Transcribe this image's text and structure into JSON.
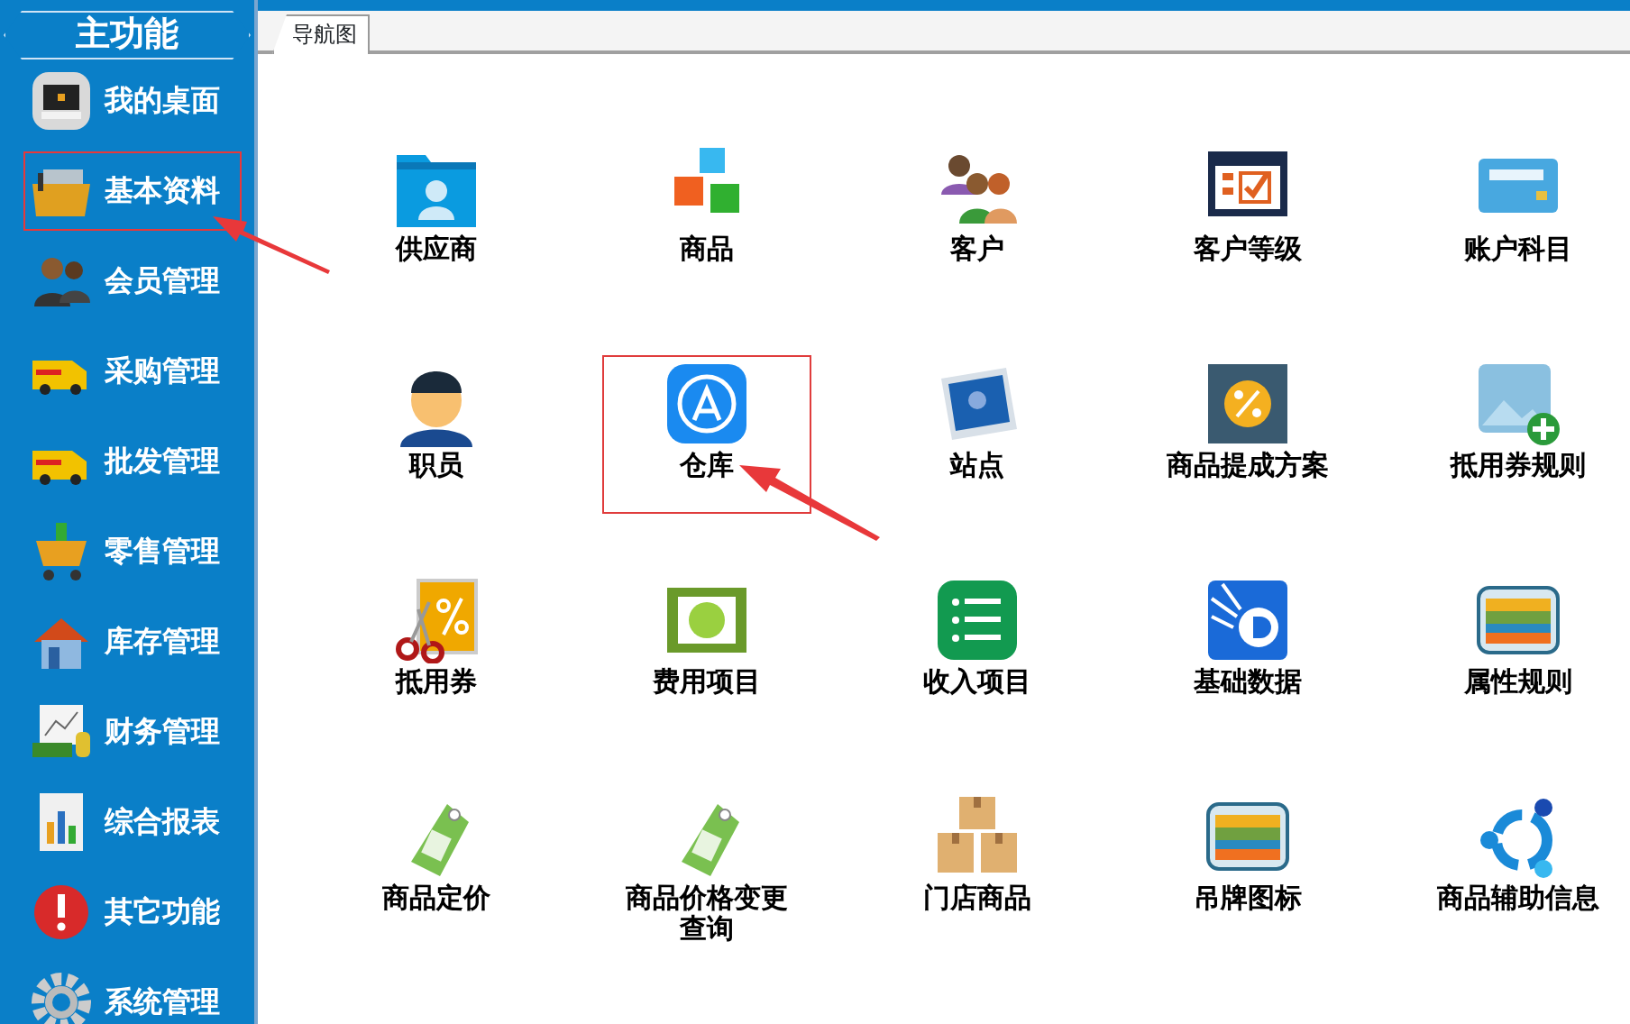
{
  "sidebar": {
    "title": "主功能",
    "items": [
      {
        "label": "我的桌面",
        "selected": false
      },
      {
        "label": "基本资料",
        "selected": true
      },
      {
        "label": "会员管理",
        "selected": false
      },
      {
        "label": "采购管理",
        "selected": false
      },
      {
        "label": "批发管理",
        "selected": false
      },
      {
        "label": "零售管理",
        "selected": false
      },
      {
        "label": "库存管理",
        "selected": false
      },
      {
        "label": "财务管理",
        "selected": false
      },
      {
        "label": "综合报表",
        "selected": false
      },
      {
        "label": "其它功能",
        "selected": false
      },
      {
        "label": "系统管理",
        "selected": false
      }
    ]
  },
  "tabs": [
    {
      "label": "导航图",
      "selected": true
    }
  ],
  "nav_grid": {
    "items": [
      {
        "label": "供应商",
        "selected": false
      },
      {
        "label": "商品",
        "selected": false
      },
      {
        "label": "客户",
        "selected": false
      },
      {
        "label": "客户等级",
        "selected": false
      },
      {
        "label": "账户科目",
        "selected": false
      },
      {
        "label": "职员",
        "selected": false
      },
      {
        "label": "仓库",
        "selected": true
      },
      {
        "label": "站点",
        "selected": false
      },
      {
        "label": "商品提成方案",
        "selected": false
      },
      {
        "label": "抵用券规则",
        "selected": false
      },
      {
        "label": "抵用券",
        "selected": false
      },
      {
        "label": "费用项目",
        "selected": false
      },
      {
        "label": "收入项目",
        "selected": false
      },
      {
        "label": "基础数据",
        "selected": false
      },
      {
        "label": "属性规则",
        "selected": false
      },
      {
        "label": "商品定价",
        "selected": false
      },
      {
        "label": "商品价格变更查询",
        "selected": false
      },
      {
        "label": "门店商品",
        "selected": false
      },
      {
        "label": "吊牌图标",
        "selected": false
      },
      {
        "label": "商品辅助信息",
        "selected": false
      }
    ]
  }
}
